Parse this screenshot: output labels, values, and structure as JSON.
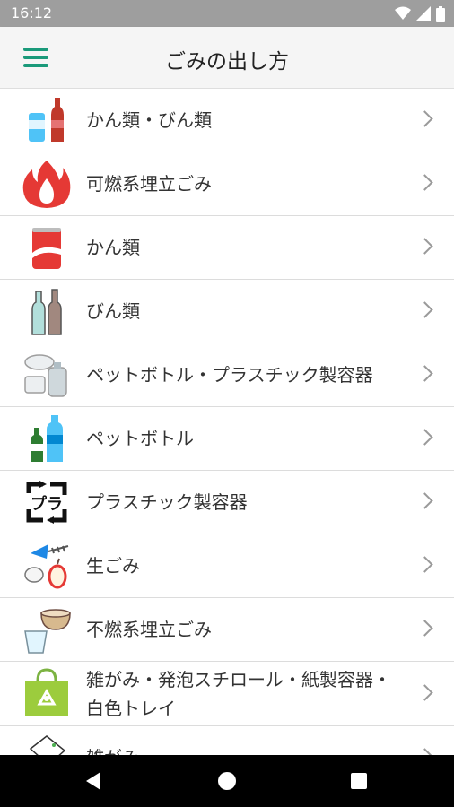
{
  "status_bar": {
    "time": "16:12"
  },
  "app_bar": {
    "title": "ごみの出し方"
  },
  "items": [
    {
      "label": "かん類・びん類",
      "icon": "can-and-bottle-icon"
    },
    {
      "label": "可燃系埋立ごみ",
      "icon": "fire-icon"
    },
    {
      "label": "かん類",
      "icon": "can-icon"
    },
    {
      "label": "びん類",
      "icon": "glass-bottles-icon"
    },
    {
      "label": "ペットボトル・プラスチック製容器",
      "icon": "pet-and-plastic-icon"
    },
    {
      "label": "ペットボトル",
      "icon": "pet-bottle-icon"
    },
    {
      "label": "プラスチック製容器",
      "icon": "plastic-recycle-mark-icon"
    },
    {
      "label": "生ごみ",
      "icon": "food-waste-icon"
    },
    {
      "label": "不燃系埋立ごみ",
      "icon": "bowl-and-glass-icon"
    },
    {
      "label": "雑がみ・発泡スチロール・紙製容器・白色トレイ",
      "icon": "recycle-bag-icon"
    },
    {
      "label": "雑がみ",
      "icon": "paper-icon"
    }
  ],
  "colors": {
    "accent": "#1a9a7a",
    "status_bar": "#9e9e9e",
    "app_bar": "#f5f5f5"
  }
}
